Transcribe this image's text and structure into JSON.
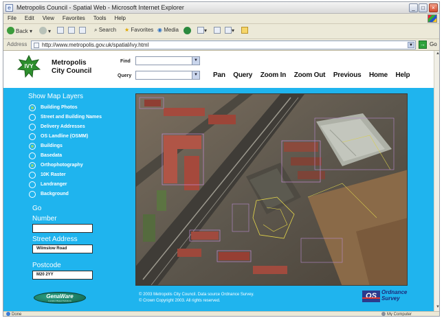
{
  "window": {
    "title": "Metropolis Council - Spatial Web - Microsoft Internet Explorer",
    "minimize": "_",
    "maximize": "□",
    "close": "×"
  },
  "menu": {
    "items": [
      "File",
      "Edit",
      "View",
      "Favorites",
      "Tools",
      "Help"
    ]
  },
  "toolbar": {
    "back": "Back",
    "search": "Search",
    "favorites": "Favorites",
    "media": "Media"
  },
  "address": {
    "label": "Address",
    "url": "http://www.metropolis.gov.uk/spatial/ivy.html",
    "go": "Go"
  },
  "header": {
    "logo_text": "IVY",
    "council_line1": "Metropolis",
    "council_line2": "City Council",
    "find_label": "Find",
    "query_label": "Query",
    "nav": [
      "Pan",
      "Query",
      "Zoom In",
      "Zoom Out",
      "Previous",
      "Home",
      "Help"
    ]
  },
  "layers": {
    "title": "Show Map Layers",
    "items": [
      {
        "label": "Building Photos",
        "checked": true
      },
      {
        "label": "Street and Building Names",
        "checked": false
      },
      {
        "label": "Delivery Addresses",
        "checked": false
      },
      {
        "label": "OS Landline (OSMM)",
        "checked": false
      },
      {
        "label": "Buildings",
        "checked": true
      },
      {
        "label": "Basedata",
        "checked": false
      },
      {
        "label": "Orthophotography",
        "checked": true
      },
      {
        "label": "10K Raster",
        "checked": false
      },
      {
        "label": "Landranger",
        "checked": false
      },
      {
        "label": "Background",
        "checked": false
      }
    ]
  },
  "form": {
    "go": "Go",
    "number_label": "Number",
    "number_value": "",
    "street_label": "Street Address",
    "street_value": "Wilmslow Road",
    "postcode_label": "Postcode",
    "postcode_value": "M20 2YY"
  },
  "footer": {
    "genaware": "GenaWare",
    "genaware_tagline": "Location Based Solutions",
    "copyright_line1": "© 2003 Metropolis City Council. Data source Ordnance Survey.",
    "copyright_line2": "© Crown Copyright 2003.  All rights reserved.",
    "os_logo_box": "OS",
    "os_logo_line1": "Ordnance",
    "os_logo_line2": "Survey"
  },
  "status": {
    "left": "Done",
    "right": "My Computer"
  },
  "colors": {
    "page_cyan": "#1fb4ee",
    "radio_on": "#8bd67a",
    "map_dark": "#6b6254"
  }
}
